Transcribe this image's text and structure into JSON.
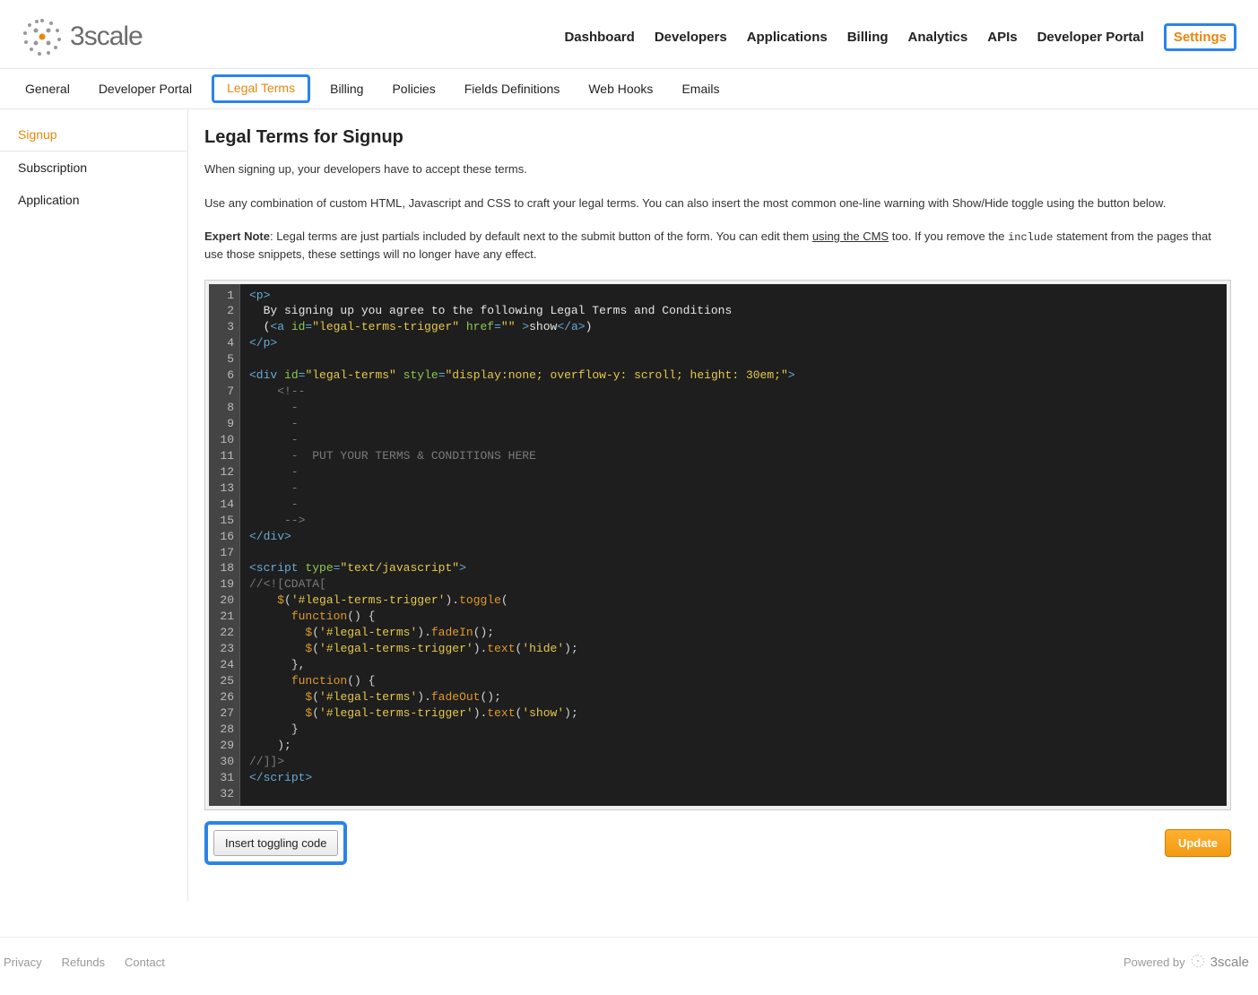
{
  "brand": {
    "name": "3scale"
  },
  "main_nav": {
    "items": [
      "Dashboard",
      "Developers",
      "Applications",
      "Billing",
      "Analytics",
      "APIs",
      "Developer Portal",
      "Settings"
    ],
    "active": "Settings"
  },
  "sub_nav": {
    "items": [
      "General",
      "Developer Portal",
      "Legal Terms",
      "Billing",
      "Policies",
      "Fields Definitions",
      "Web Hooks",
      "Emails"
    ],
    "active": "Legal Terms"
  },
  "sidebar": {
    "items": [
      "Signup",
      "Subscription",
      "Application"
    ],
    "active": "Signup"
  },
  "page": {
    "title": "Legal Terms for Signup",
    "intro1": "When signing up, your developers have to accept these terms.",
    "intro2": "Use any combination of custom HTML, Javascript and CSS to craft your legal terms. You can also insert the most common one-line warning with Show/Hide toggle using the button below.",
    "expert_label": "Expert Note",
    "expert_text_1": ": Legal terms are just partials included by default next to the submit button of the form. You can edit them ",
    "expert_link": "using the CMS",
    "expert_text_2": " too. If you remove the ",
    "expert_code": "include",
    "expert_text_3": " statement from the pages that use those snippets, these settings will no longer have any effect."
  },
  "editor": {
    "line_count": 32,
    "lines": [
      {
        "segs": [
          {
            "c": "c-tag",
            "t": "<p>"
          }
        ]
      },
      {
        "segs": [
          {
            "c": "c-text",
            "t": "  By signing up you agree to the following Legal Terms and Conditions"
          }
        ]
      },
      {
        "segs": [
          {
            "c": "c-text",
            "t": "  ("
          },
          {
            "c": "c-tag",
            "t": "<a "
          },
          {
            "c": "c-attr",
            "t": "id"
          },
          {
            "c": "c-tag",
            "t": "="
          },
          {
            "c": "c-str",
            "t": "\"legal-terms-trigger\""
          },
          {
            "c": "c-tag",
            "t": " "
          },
          {
            "c": "c-attr",
            "t": "href"
          },
          {
            "c": "c-tag",
            "t": "="
          },
          {
            "c": "c-str",
            "t": "\"\""
          },
          {
            "c": "c-tag",
            "t": " >"
          },
          {
            "c": "c-text",
            "t": "show"
          },
          {
            "c": "c-tag",
            "t": "</a>"
          },
          {
            "c": "c-text",
            "t": ")"
          }
        ]
      },
      {
        "segs": [
          {
            "c": "c-tag",
            "t": "</p>"
          }
        ]
      },
      {
        "segs": [
          {
            "c": "c-text",
            "t": ""
          }
        ]
      },
      {
        "segs": [
          {
            "c": "c-tag",
            "t": "<div "
          },
          {
            "c": "c-attr",
            "t": "id"
          },
          {
            "c": "c-tag",
            "t": "="
          },
          {
            "c": "c-str",
            "t": "\"legal-terms\""
          },
          {
            "c": "c-tag",
            "t": " "
          },
          {
            "c": "c-attr",
            "t": "style"
          },
          {
            "c": "c-tag",
            "t": "="
          },
          {
            "c": "c-str",
            "t": "\"display:none; overflow-y: scroll; height: 30em;\""
          },
          {
            "c": "c-tag",
            "t": ">"
          }
        ]
      },
      {
        "segs": [
          {
            "c": "c-dim",
            "t": "    <!--"
          }
        ]
      },
      {
        "segs": [
          {
            "c": "c-dim",
            "t": "      -"
          }
        ]
      },
      {
        "segs": [
          {
            "c": "c-dim",
            "t": "      -"
          }
        ]
      },
      {
        "segs": [
          {
            "c": "c-dim",
            "t": "      -"
          }
        ]
      },
      {
        "segs": [
          {
            "c": "c-dim",
            "t": "      -  PUT YOUR TERMS & CONDITIONS HERE"
          }
        ]
      },
      {
        "segs": [
          {
            "c": "c-dim",
            "t": "      -"
          }
        ]
      },
      {
        "segs": [
          {
            "c": "c-dim",
            "t": "      -"
          }
        ]
      },
      {
        "segs": [
          {
            "c": "c-dim",
            "t": "      -"
          }
        ]
      },
      {
        "segs": [
          {
            "c": "c-dim",
            "t": "     -->"
          }
        ]
      },
      {
        "segs": [
          {
            "c": "c-tag",
            "t": "</div>"
          }
        ]
      },
      {
        "segs": [
          {
            "c": "c-text",
            "t": ""
          }
        ]
      },
      {
        "segs": [
          {
            "c": "c-tag",
            "t": "<script "
          },
          {
            "c": "c-attr",
            "t": "type"
          },
          {
            "c": "c-tag",
            "t": "="
          },
          {
            "c": "c-str",
            "t": "\"text/javascript\""
          },
          {
            "c": "c-tag",
            "t": ">"
          }
        ]
      },
      {
        "segs": [
          {
            "c": "c-dim",
            "t": "//<![CDATA["
          }
        ]
      },
      {
        "segs": [
          {
            "c": "c-text",
            "t": "    "
          },
          {
            "c": "c-kw",
            "t": "$"
          },
          {
            "c": "c-op",
            "t": "("
          },
          {
            "c": "c-str",
            "t": "'#legal-terms-trigger'"
          },
          {
            "c": "c-op",
            "t": ")."
          },
          {
            "c": "c-kw",
            "t": "toggle"
          },
          {
            "c": "c-op",
            "t": "("
          }
        ]
      },
      {
        "segs": [
          {
            "c": "c-text",
            "t": "      "
          },
          {
            "c": "c-kw",
            "t": "function"
          },
          {
            "c": "c-op",
            "t": "() {"
          }
        ]
      },
      {
        "segs": [
          {
            "c": "c-text",
            "t": "        "
          },
          {
            "c": "c-kw",
            "t": "$"
          },
          {
            "c": "c-op",
            "t": "("
          },
          {
            "c": "c-str",
            "t": "'#legal-terms'"
          },
          {
            "c": "c-op",
            "t": ")."
          },
          {
            "c": "c-kw",
            "t": "fadeIn"
          },
          {
            "c": "c-op",
            "t": "();"
          }
        ]
      },
      {
        "segs": [
          {
            "c": "c-text",
            "t": "        "
          },
          {
            "c": "c-kw",
            "t": "$"
          },
          {
            "c": "c-op",
            "t": "("
          },
          {
            "c": "c-str",
            "t": "'#legal-terms-trigger'"
          },
          {
            "c": "c-op",
            "t": ")."
          },
          {
            "c": "c-kw",
            "t": "text"
          },
          {
            "c": "c-op",
            "t": "("
          },
          {
            "c": "c-str",
            "t": "'hide'"
          },
          {
            "c": "c-op",
            "t": ");"
          }
        ]
      },
      {
        "segs": [
          {
            "c": "c-text",
            "t": "      "
          },
          {
            "c": "c-op",
            "t": "},"
          }
        ]
      },
      {
        "segs": [
          {
            "c": "c-text",
            "t": "      "
          },
          {
            "c": "c-kw",
            "t": "function"
          },
          {
            "c": "c-op",
            "t": "() {"
          }
        ]
      },
      {
        "segs": [
          {
            "c": "c-text",
            "t": "        "
          },
          {
            "c": "c-kw",
            "t": "$"
          },
          {
            "c": "c-op",
            "t": "("
          },
          {
            "c": "c-str",
            "t": "'#legal-terms'"
          },
          {
            "c": "c-op",
            "t": ")."
          },
          {
            "c": "c-kw",
            "t": "fadeOut"
          },
          {
            "c": "c-op",
            "t": "();"
          }
        ]
      },
      {
        "segs": [
          {
            "c": "c-text",
            "t": "        "
          },
          {
            "c": "c-kw",
            "t": "$"
          },
          {
            "c": "c-op",
            "t": "("
          },
          {
            "c": "c-str",
            "t": "'#legal-terms-trigger'"
          },
          {
            "c": "c-op",
            "t": ")."
          },
          {
            "c": "c-kw",
            "t": "text"
          },
          {
            "c": "c-op",
            "t": "("
          },
          {
            "c": "c-str",
            "t": "'show'"
          },
          {
            "c": "c-op",
            "t": ");"
          }
        ]
      },
      {
        "segs": [
          {
            "c": "c-text",
            "t": "      "
          },
          {
            "c": "c-op",
            "t": "}"
          }
        ]
      },
      {
        "segs": [
          {
            "c": "c-text",
            "t": "    "
          },
          {
            "c": "c-op",
            "t": ");"
          }
        ]
      },
      {
        "segs": [
          {
            "c": "c-dim",
            "t": "//]]>"
          }
        ]
      },
      {
        "segs": [
          {
            "c": "c-tag",
            "t": "</"
          },
          {
            "c": "c-tag",
            "t": "script>"
          }
        ]
      },
      {
        "segs": [
          {
            "c": "c-text",
            "t": ""
          }
        ]
      }
    ]
  },
  "buttons": {
    "toggle": "Insert toggling code",
    "update": "Update"
  },
  "footer": {
    "links": [
      "Privacy",
      "Refunds",
      "Contact"
    ],
    "powered": "Powered by",
    "brand": "3scale"
  }
}
